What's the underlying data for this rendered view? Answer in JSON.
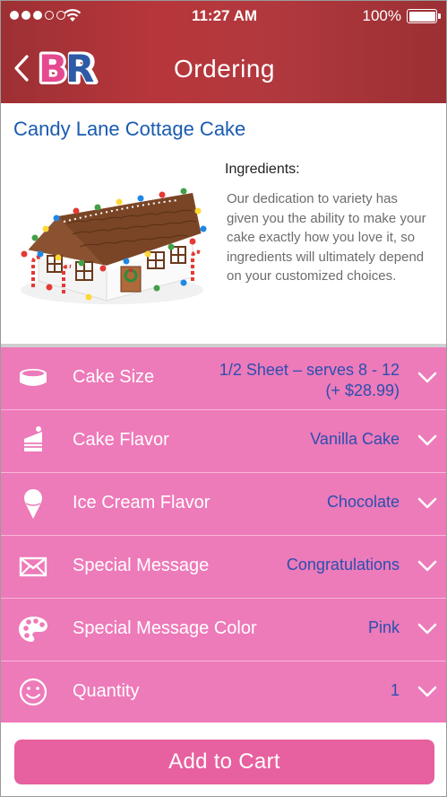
{
  "status": {
    "time": "11:27 AM",
    "battery": "100%"
  },
  "header": {
    "title": "Ordering",
    "logo_text": "BR"
  },
  "product": {
    "title": "Candy Lane Cottage Cake",
    "ingredients_label": "Ingredients:",
    "ingredients_text": "Our dedication to variety has given you the ability to make your cake exactly how you love it, so ingredients will ultimately depend on your customized choices."
  },
  "options": [
    {
      "label": "Cake Size",
      "value": "1/2 Sheet – serves 8 - 12",
      "value2": "(+ $28.99)",
      "icon": "cake-pan-icon"
    },
    {
      "label": "Cake Flavor",
      "value": "Vanilla Cake",
      "icon": "cake-slice-icon"
    },
    {
      "label": "Ice Cream Flavor",
      "value": "Chocolate",
      "icon": "ice-cream-cone-icon"
    },
    {
      "label": "Special Message",
      "value": "Congratulations",
      "icon": "envelope-icon"
    },
    {
      "label": "Special Message Color",
      "value": "Pink",
      "icon": "palette-icon"
    },
    {
      "label": "Quantity",
      "value": "1",
      "icon": "smiley-icon"
    }
  ],
  "add_to_cart": "Add to Cart",
  "colors": {
    "header": "#b1393e",
    "options_bg": "#ed7ab9",
    "value_text": "#2a4fb0",
    "button": "#e7609f",
    "title": "#1a5bb0"
  }
}
